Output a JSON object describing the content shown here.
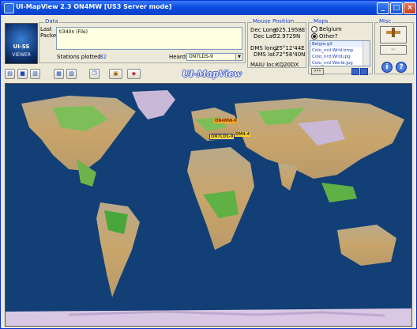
{
  "window": {
    "title": "UI-MapView 2.3 ON4MW [US3 Server mode]",
    "minimize": "_",
    "maximize": "□",
    "close": "×"
  },
  "logo": {
    "line1": "UI-SS",
    "line2": "VIEWER"
  },
  "data_group": {
    "label": "Data",
    "last_label": "Last",
    "packet_label": "Packet:",
    "packet_text": "ti340n (File)",
    "stations_label": "Stations plotted:",
    "stations_count": "32",
    "heard_label": "Heard:",
    "heard_value": "ON7LDS-9"
  },
  "mouse_group": {
    "label": "Mouse Position",
    "dec_long_label": "Dec Long:",
    "dec_long": "-025.1958E",
    "dec_lat_label": "Dec Lat:",
    "dec_lat": "72.9729N",
    "dms_long_label": "DMS long:",
    "dms_long": "25°12'44E",
    "dms_lat_label": "DMS lat:",
    "dms_lat": "72°58'40N",
    "maidenhead_label": "MAIU loc:",
    "maidenhead": "KQ20DX"
  },
  "maps_group": {
    "label": "Maps",
    "options": [
      "Belgium",
      "Other?"
    ],
    "selected_option": "Other?",
    "files": [
      "Belgie.gif",
      "Colo_nrd Wrld.bmp",
      "Colo_nrd Wrld.jpg",
      "Colo_nrd World.jpg"
    ],
    "nav_button": "•••"
  },
  "misc_group": {
    "label": "Misc",
    "help": "?",
    "info": "i"
  },
  "toolbar": {
    "brand": "UI-MapView"
  },
  "map_stations": [
    {
      "name": "ON4MW-9",
      "color": "#f5a623"
    },
    {
      "name": "ON7LDS-9",
      "color": "#f4e04a"
    },
    {
      "name": "DM4-4",
      "color": "#ffd21a"
    }
  ]
}
